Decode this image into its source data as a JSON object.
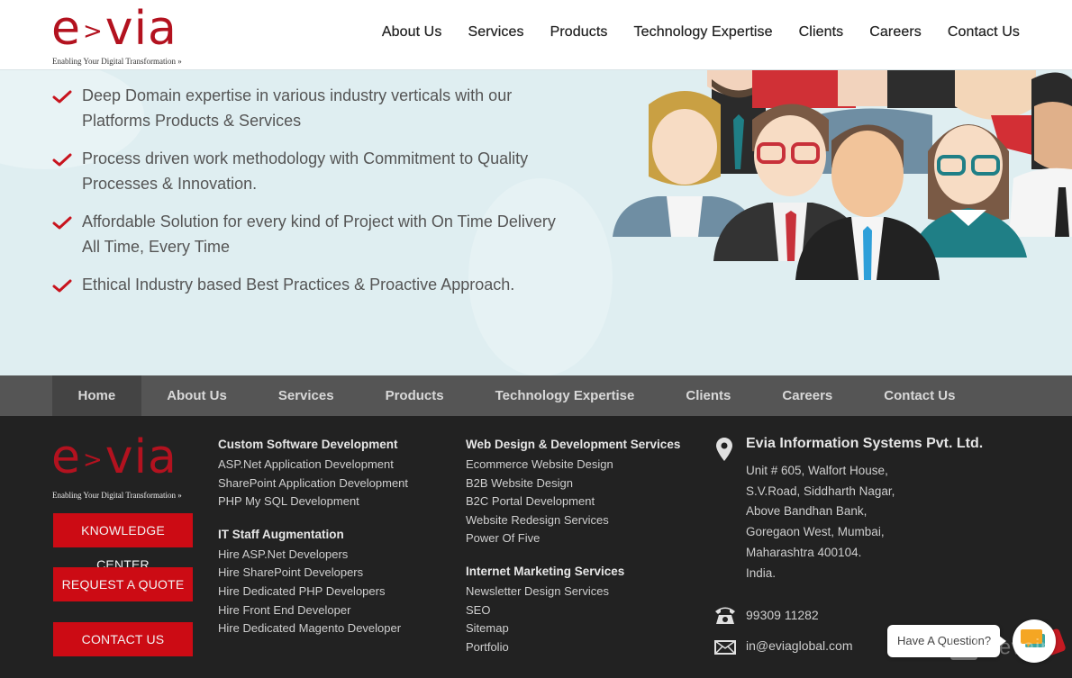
{
  "brand": {
    "name": "e>via",
    "word_left": "e",
    "word_gt": ">",
    "word_right": "via",
    "tagline": "Enabling Your Digital Transformation",
    "tagline_arrows": "»",
    "color": "#b3121f"
  },
  "top_nav": {
    "items": [
      {
        "label": "About Us"
      },
      {
        "label": "Services"
      },
      {
        "label": "Products"
      },
      {
        "label": "Technology Expertise"
      },
      {
        "label": "Clients"
      },
      {
        "label": "Careers"
      },
      {
        "label": "Contact Us"
      }
    ]
  },
  "hero": {
    "features": [
      {
        "text": "Deep Domain expertise in various industry verticals with our Platforms Products & Services"
      },
      {
        "text": "Process driven work methodology with Commitment to Quality Processes & Innovation."
      },
      {
        "text": "Affordable Solution for every kind of Project with On Time Delivery All Time, Every Time"
      },
      {
        "text": "Ethical Industry based Best Practices & Proactive Approach."
      }
    ],
    "illustration": "team-of-professionals-illustration"
  },
  "bottom_nav": {
    "active": "Home",
    "items": [
      {
        "label": "Home"
      },
      {
        "label": "About Us"
      },
      {
        "label": "Services"
      },
      {
        "label": "Products"
      },
      {
        "label": "Technology Expertise"
      },
      {
        "label": "Clients"
      },
      {
        "label": "Careers"
      },
      {
        "label": "Contact Us"
      }
    ]
  },
  "footer": {
    "buttons": {
      "knowledge_center": "KNOWLEDGE CENTER",
      "request_quote": "REQUEST A QUOTE",
      "contact_us": "CONTACT US"
    },
    "col1": {
      "heading1": "Custom Software Development",
      "links1": [
        "ASP.Net Application Development",
        "SharePoint Application Development",
        "PHP My SQL Development"
      ],
      "heading2": "IT Staff Augmentation",
      "links2": [
        "Hire ASP.Net Developers",
        "Hire SharePoint Developers",
        "Hire Dedicated PHP Developers",
        "Hire Front End Developer",
        "Hire Dedicated Magento Developer"
      ]
    },
    "col2": {
      "heading1": "Web Design & Development Services",
      "links1": [
        "Ecommerce Website Design",
        "B2B Website Design",
        "B2C Portal Development",
        "Website Redesign Services",
        "Power Of Five"
      ],
      "heading2": "Internet Marketing Services",
      "links2": [
        "Newsletter Design Services",
        "SEO",
        "Sitemap",
        "Portfolio"
      ]
    },
    "address": {
      "company": "Evia Information Systems Pvt. Ltd.",
      "lines": [
        "Unit # 605, Walfort House,",
        "S.V.Road, Siddharth Nagar,",
        "Above Bandhan Bank,",
        "Goregaon West, Mumbai,",
        "Maharashtra 400104.",
        "India."
      ]
    },
    "phone": "99309 11282",
    "email": "in@eviaglobal.com"
  },
  "chat": {
    "prompt": "Have A Question?"
  },
  "watermark": "Revain",
  "colors": {
    "accent_red": "#cc0b14",
    "hero_bg": "#dfeef1",
    "nav_bar": "#555555",
    "nav_active": "#444444",
    "footer_bg": "#222222"
  }
}
